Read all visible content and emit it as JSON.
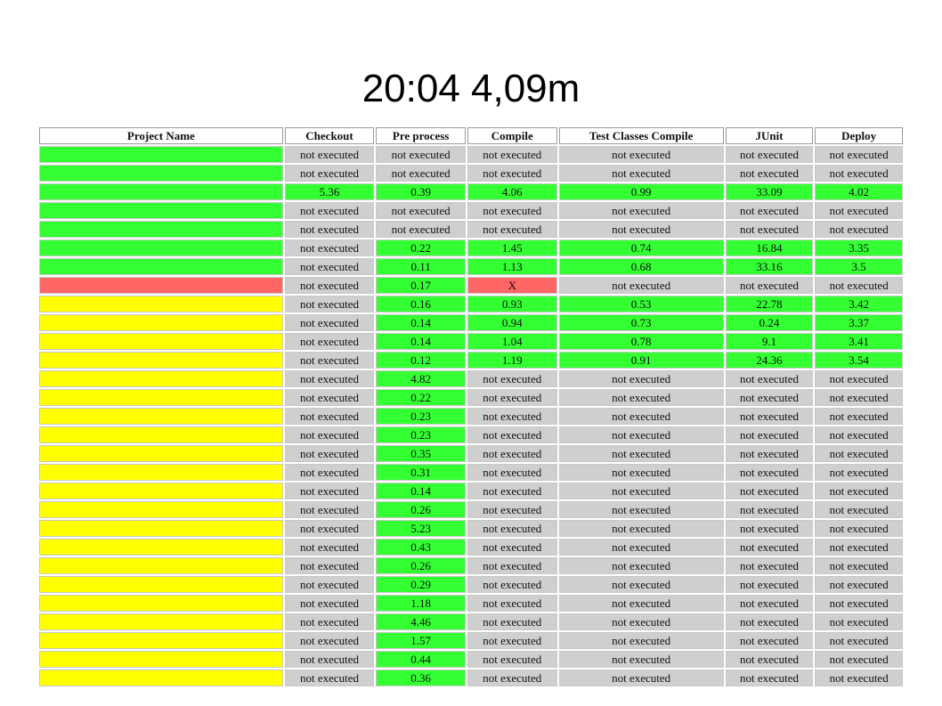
{
  "title": "20:04 4,09m",
  "colors": {
    "ok": "#33ff33",
    "fail": "#ff6666",
    "warn": "#ffff00",
    "not_executed": "#cfcfcf"
  },
  "columns": [
    "Project Name",
    "Checkout",
    "Pre process",
    "Compile",
    "Test Classes Compile",
    "JUnit",
    "Deploy"
  ],
  "rows": [
    {
      "status": "green",
      "checkout": "not executed",
      "preprocess": "not executed",
      "compile": "not executed",
      "test_compile": "not executed",
      "junit": "not executed",
      "deploy": "not executed"
    },
    {
      "status": "green",
      "checkout": "not executed",
      "preprocess": "not executed",
      "compile": "not executed",
      "test_compile": "not executed",
      "junit": "not executed",
      "deploy": "not executed"
    },
    {
      "status": "green",
      "checkout": "5.36",
      "preprocess": "0.39",
      "compile": "4.06",
      "test_compile": "0.99",
      "junit": "33.09",
      "deploy": "4.02"
    },
    {
      "status": "green",
      "checkout": "not executed",
      "preprocess": "not executed",
      "compile": "not executed",
      "test_compile": "not executed",
      "junit": "not executed",
      "deploy": "not executed"
    },
    {
      "status": "green",
      "checkout": "not executed",
      "preprocess": "not executed",
      "compile": "not executed",
      "test_compile": "not executed",
      "junit": "not executed",
      "deploy": "not executed"
    },
    {
      "status": "green",
      "checkout": "not executed",
      "preprocess": "0.22",
      "compile": "1.45",
      "test_compile": "0.74",
      "junit": "16.84",
      "deploy": "3.35"
    },
    {
      "status": "green",
      "checkout": "not executed",
      "preprocess": "0.11",
      "compile": "1.13",
      "test_compile": "0.68",
      "junit": "33.16",
      "deploy": "3.5"
    },
    {
      "status": "red",
      "checkout": "not executed",
      "preprocess": "0.17",
      "compile": "X",
      "test_compile": "not executed",
      "junit": "not executed",
      "deploy": "not executed"
    },
    {
      "status": "yellow",
      "checkout": "not executed",
      "preprocess": "0.16",
      "compile": "0.93",
      "test_compile": "0.53",
      "junit": "22.78",
      "deploy": "3.42"
    },
    {
      "status": "yellow",
      "checkout": "not executed",
      "preprocess": "0.14",
      "compile": "0.94",
      "test_compile": "0.73",
      "junit": "0.24",
      "deploy": "3.37"
    },
    {
      "status": "yellow",
      "checkout": "not executed",
      "preprocess": "0.14",
      "compile": "1.04",
      "test_compile": "0.78",
      "junit": "9.1",
      "deploy": "3.41"
    },
    {
      "status": "yellow",
      "checkout": "not executed",
      "preprocess": "0.12",
      "compile": "1.19",
      "test_compile": "0.91",
      "junit": "24.36",
      "deploy": "3.54"
    },
    {
      "status": "yellow",
      "checkout": "not executed",
      "preprocess": "4.82",
      "compile": "not executed",
      "test_compile": "not executed",
      "junit": "not executed",
      "deploy": "not executed"
    },
    {
      "status": "yellow",
      "checkout": "not executed",
      "preprocess": "0.22",
      "compile": "not executed",
      "test_compile": "not executed",
      "junit": "not executed",
      "deploy": "not executed"
    },
    {
      "status": "yellow",
      "checkout": "not executed",
      "preprocess": "0.23",
      "compile": "not executed",
      "test_compile": "not executed",
      "junit": "not executed",
      "deploy": "not executed"
    },
    {
      "status": "yellow",
      "checkout": "not executed",
      "preprocess": "0.23",
      "compile": "not executed",
      "test_compile": "not executed",
      "junit": "not executed",
      "deploy": "not executed"
    },
    {
      "status": "yellow",
      "checkout": "not executed",
      "preprocess": "0.35",
      "compile": "not executed",
      "test_compile": "not executed",
      "junit": "not executed",
      "deploy": "not executed"
    },
    {
      "status": "yellow",
      "checkout": "not executed",
      "preprocess": "0.31",
      "compile": "not executed",
      "test_compile": "not executed",
      "junit": "not executed",
      "deploy": "not executed"
    },
    {
      "status": "yellow",
      "checkout": "not executed",
      "preprocess": "0.14",
      "compile": "not executed",
      "test_compile": "not executed",
      "junit": "not executed",
      "deploy": "not executed"
    },
    {
      "status": "yellow",
      "checkout": "not executed",
      "preprocess": "0.26",
      "compile": "not executed",
      "test_compile": "not executed",
      "junit": "not executed",
      "deploy": "not executed"
    },
    {
      "status": "yellow",
      "checkout": "not executed",
      "preprocess": "5.23",
      "compile": "not executed",
      "test_compile": "not executed",
      "junit": "not executed",
      "deploy": "not executed"
    },
    {
      "status": "yellow",
      "checkout": "not executed",
      "preprocess": "0.43",
      "compile": "not executed",
      "test_compile": "not executed",
      "junit": "not executed",
      "deploy": "not executed"
    },
    {
      "status": "yellow",
      "checkout": "not executed",
      "preprocess": "0.26",
      "compile": "not executed",
      "test_compile": "not executed",
      "junit": "not executed",
      "deploy": "not executed"
    },
    {
      "status": "yellow",
      "checkout": "not executed",
      "preprocess": "0.29",
      "compile": "not executed",
      "test_compile": "not executed",
      "junit": "not executed",
      "deploy": "not executed"
    },
    {
      "status": "yellow",
      "checkout": "not executed",
      "preprocess": "1.18",
      "compile": "not executed",
      "test_compile": "not executed",
      "junit": "not executed",
      "deploy": "not executed"
    },
    {
      "status": "yellow",
      "checkout": "not executed",
      "preprocess": "4.46",
      "compile": "not executed",
      "test_compile": "not executed",
      "junit": "not executed",
      "deploy": "not executed"
    },
    {
      "status": "yellow",
      "checkout": "not executed",
      "preprocess": "1.57",
      "compile": "not executed",
      "test_compile": "not executed",
      "junit": "not executed",
      "deploy": "not executed"
    },
    {
      "status": "yellow",
      "checkout": "not executed",
      "preprocess": "0.44",
      "compile": "not executed",
      "test_compile": "not executed",
      "junit": "not executed",
      "deploy": "not executed"
    },
    {
      "status": "yellow",
      "checkout": "not executed",
      "preprocess": "0.36",
      "compile": "not executed",
      "test_compile": "not executed",
      "junit": "not executed",
      "deploy": "not executed"
    }
  ]
}
